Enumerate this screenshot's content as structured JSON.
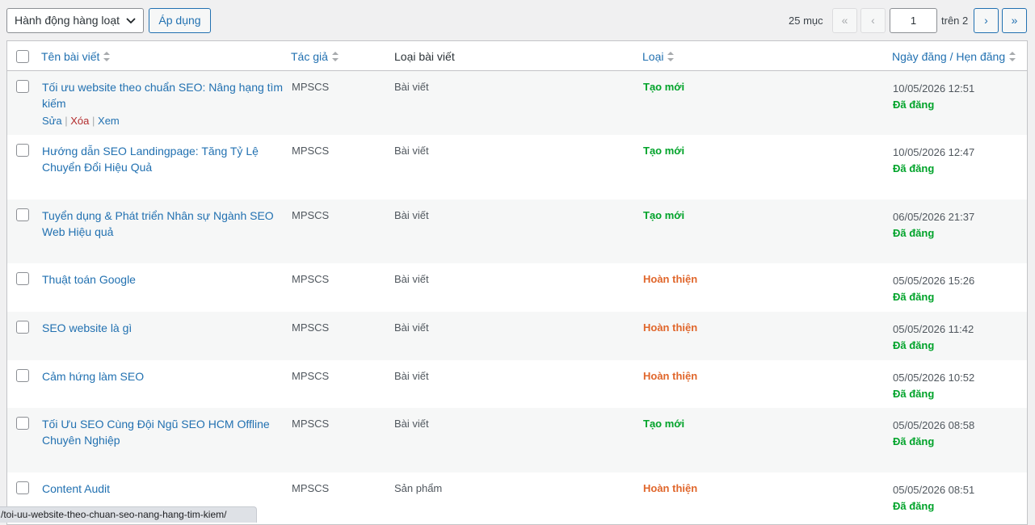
{
  "toolbar": {
    "bulk_action": "Hành động hàng loạt",
    "apply": "Áp dụng",
    "item_count": "25 mục",
    "first": "«",
    "prev": "‹",
    "current_page": "1",
    "of_pages": "trên 2",
    "next": "›",
    "last": "»"
  },
  "columns": {
    "title": "Tên bài viết",
    "author": "Tác giả",
    "post_type": "Loại bài viết",
    "type": "Loại",
    "date": "Ngày đăng / Hẹn đăng"
  },
  "row_actions": {
    "edit": "Sửa",
    "delete": "Xóa",
    "view": "Xem",
    "sep": "|"
  },
  "rows": [
    {
      "title": "Tối ưu website theo chuẩn SEO: Nâng hạng tìm kiếm",
      "author": "MPSCS",
      "post_type": "Bài viết",
      "type": "Tạo mới",
      "date": "10/05/2026 12:51",
      "status": "Đã đăng"
    },
    {
      "title": "Hướng dẫn SEO Landingpage: Tăng Tỷ Lệ Chuyển Đổi Hiệu Quả",
      "author": "MPSCS",
      "post_type": "Bài viết",
      "type": "Tạo mới",
      "date": "10/05/2026 12:47",
      "status": "Đã đăng"
    },
    {
      "title": "Tuyển dụng & Phát triển Nhân sự Ngành SEO Web Hiệu quả",
      "author": "MPSCS",
      "post_type": "Bài viết",
      "type": "Tạo mới",
      "date": "06/05/2026 21:37",
      "status": "Đã đăng"
    },
    {
      "title": "Thuật toán Google",
      "author": "MPSCS",
      "post_type": "Bài viết",
      "type": "Hoàn thiện",
      "date": "05/05/2026 15:26",
      "status": "Đã đăng"
    },
    {
      "title": "SEO website là gì",
      "author": "MPSCS",
      "post_type": "Bài viết",
      "type": "Hoàn thiện",
      "date": "05/05/2026 11:42",
      "status": "Đã đăng"
    },
    {
      "title": "Cảm hứng làm SEO",
      "author": "MPSCS",
      "post_type": "Bài viết",
      "type": "Hoàn thiện",
      "date": "05/05/2026 10:52",
      "status": "Đã đăng"
    },
    {
      "title": "Tối Ưu SEO Cùng Đội Ngũ SEO HCM Offline Chuyên Nghiệp",
      "author": "MPSCS",
      "post_type": "Bài viết",
      "type": "Tạo mới",
      "date": "05/05/2026 08:58",
      "status": "Đã đăng"
    },
    {
      "title": "Content Audit",
      "author": "MPSCS",
      "post_type": "Sản phẩm",
      "type": "Hoàn thiện",
      "date": "05/05/2026 08:51",
      "status": "Đã đăng"
    }
  ],
  "statusbar_url": "/toi-uu-website-theo-chuan-seo-nang-hang-tim-kiem/",
  "colors": {
    "link": "#2271b1",
    "type_new": "#00a32a",
    "type_done": "#e0662b",
    "published": "#00a32a",
    "delete": "#b32d2e"
  }
}
